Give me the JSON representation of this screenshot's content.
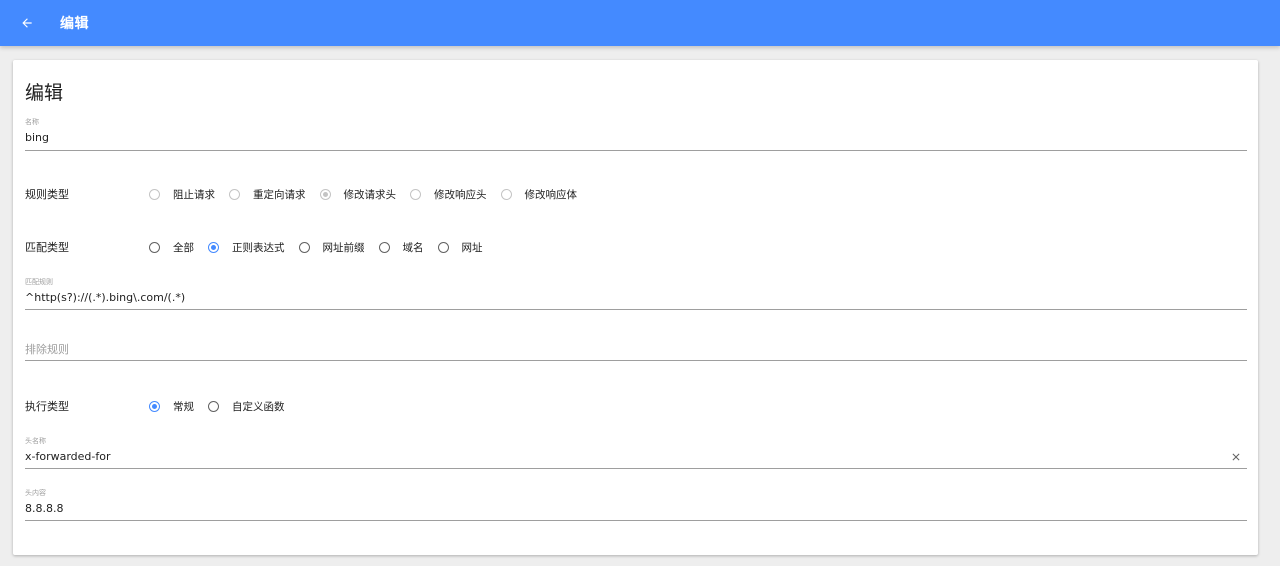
{
  "appbar": {
    "back_icon": "arrow-left-icon",
    "title": "编辑",
    "color": "#448aff"
  },
  "card": {
    "title": "编辑"
  },
  "name_field": {
    "label": "名称",
    "value": "bing"
  },
  "rule_type": {
    "label": "规则类型",
    "options": [
      "阻止请求",
      "重定向请求",
      "修改请求头",
      "修改响应头",
      "修改响应体"
    ],
    "selected": "修改请求头",
    "disabled": true
  },
  "match_type": {
    "label": "匹配类型",
    "options": [
      "全部",
      "正则表达式",
      "网址前缀",
      "域名",
      "网址"
    ],
    "selected": "正则表达式"
  },
  "match_rule_field": {
    "label": "匹配规则",
    "value": "^http(s?)://(.*).bing\\.com/(.*)"
  },
  "exclude_rule_field": {
    "placeholder": "排除规则"
  },
  "exec_type": {
    "label": "执行类型",
    "options": [
      "常规",
      "自定义函数"
    ],
    "selected": "常规"
  },
  "header_name_field": {
    "label": "头名称",
    "value": "x-forwarded-for",
    "clear_icon": "close-icon"
  },
  "header_content_field": {
    "label": "头内容",
    "value": "8.8.8.8"
  },
  "colors": {
    "accent": "#448aff",
    "underline": "#9e9e9e",
    "disabled": "#c4c4c4"
  }
}
